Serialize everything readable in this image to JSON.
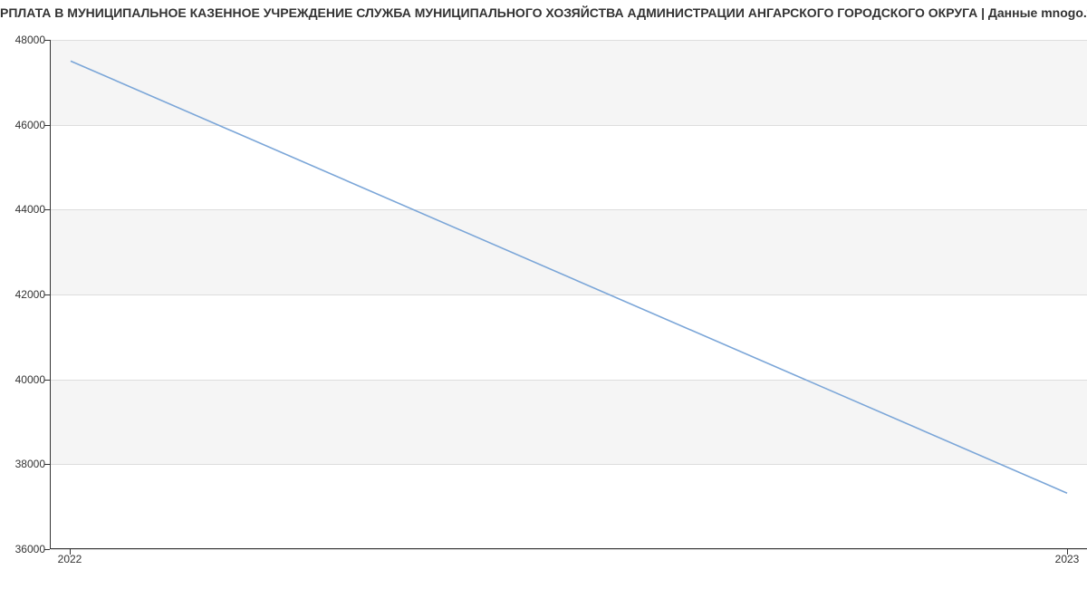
{
  "chart_data": {
    "type": "line",
    "title": "РПЛАТА В МУНИЦИПАЛЬНОЕ КАЗЕННОЕ УЧРЕЖДЕНИЕ СЛУЖБА МУНИЦИПАЛЬНОГО ХОЗЯЙСТВА АДМИНИСТРАЦИИ АНГАРСКОГО ГОРОДСКОГО ОКРУГА | Данные mnogo.wo",
    "categories": [
      "2022",
      "2023"
    ],
    "values": [
      47500,
      37300
    ],
    "xlabel": "",
    "ylabel": "",
    "ylim": [
      36000,
      48000
    ],
    "yticks": [
      36000,
      38000,
      40000,
      42000,
      44000,
      46000,
      48000
    ],
    "line_color": "#7ba6d8",
    "band_color": "#f5f5f5",
    "grid_color": "#dddddd"
  }
}
